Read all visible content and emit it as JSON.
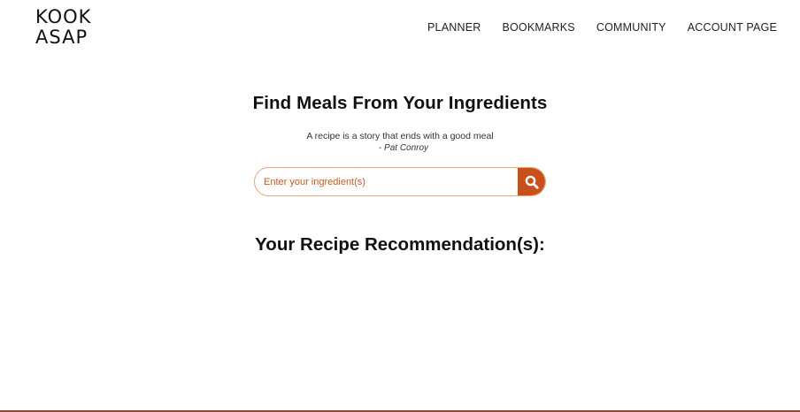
{
  "brand": {
    "line1": "KOOK",
    "line2": "ASAP"
  },
  "nav": {
    "items": [
      {
        "label": "PLANNER"
      },
      {
        "label": "BOOKMARKS"
      },
      {
        "label": "COMMUNITY"
      },
      {
        "label": "ACCOUNT PAGE"
      }
    ]
  },
  "hero": {
    "title": "Find Meals From Your Ingredients",
    "quote": "A recipe is a story that ends with a good meal",
    "author": "- Pat Conroy"
  },
  "search": {
    "placeholder": "Enter your ingredient(s)",
    "value": "",
    "icon": "search-icon"
  },
  "recommendations": {
    "title": "Your Recipe Recommendation(s):",
    "items": []
  },
  "colors": {
    "accent": "#c9501a",
    "input_border": "#e8a57a",
    "footer_line": "#8a4a3a"
  }
}
